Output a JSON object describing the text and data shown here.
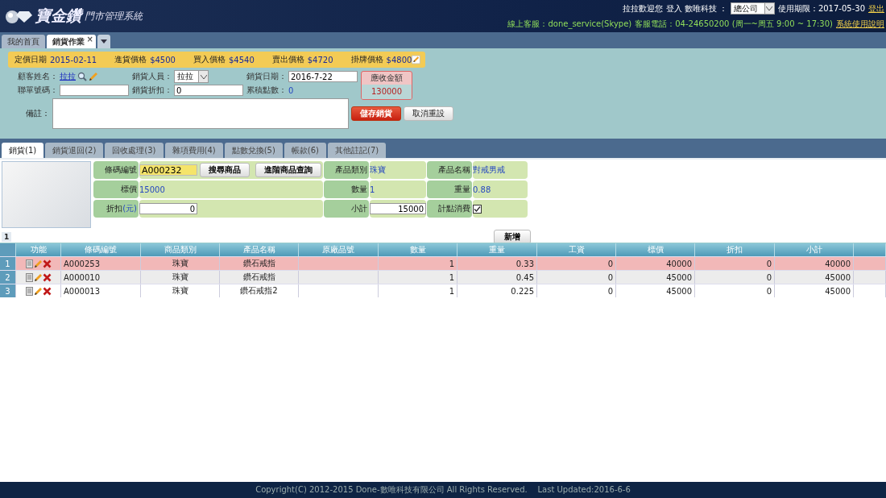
{
  "header": {
    "logo": "寶金鑽",
    "subtitle": "門市管理系統",
    "welcome": "拉拉歡迎您",
    "login_label": "登入 數唯科技 ：",
    "branch": "總公司",
    "expiry": "使用期限：2017-05-30",
    "logout": "登出",
    "support": "線上客服：done_service(Skype)",
    "phone": "客服電話：04-24650200 (周一~周五 9:00 ~ 17:30)",
    "manual": "系統使用說明"
  },
  "page_tabs": [
    {
      "label": "我的首頁",
      "selected": false
    },
    {
      "label": "銷貨作業",
      "selected": true,
      "close": "×"
    }
  ],
  "price_bar": {
    "date_label": "定價日期",
    "date": "2015-02-11",
    "prices": [
      {
        "label": "進貨價格",
        "value": "$4500"
      },
      {
        "label": "買入價格",
        "value": "$4540"
      },
      {
        "label": "賣出價格",
        "value": "$4720"
      },
      {
        "label": "掛牌價格",
        "value": "$4800"
      }
    ]
  },
  "form": {
    "customer_label": "顧客姓名：",
    "customer": "拉拉",
    "seller_label": "銷貨人員：",
    "seller": "拉拉",
    "date_label": "銷貨日期：",
    "date": "2016-7-22",
    "receivable_label": "應收金額",
    "receivable": "130000",
    "slip_label": "聯單號碼：",
    "discount_label": "銷貨折扣：",
    "discount": "0",
    "points_label": "累積點數：",
    "points": "0",
    "note_label": "備註：",
    "save": "儲存銷貨",
    "cancel": "取消重設"
  },
  "detail_tabs": [
    {
      "label": "銷貨(1)",
      "selected": true
    },
    {
      "label": "銷貨退回(2)",
      "selected": false
    },
    {
      "label": "回收處理(3)",
      "selected": false
    },
    {
      "label": "雜項費用(4)",
      "selected": false
    },
    {
      "label": "點數兌換(5)",
      "selected": false
    },
    {
      "label": "帳款(6)",
      "selected": false
    },
    {
      "label": "其他註記(7)",
      "selected": false
    }
  ],
  "product": {
    "barcode_label": "條碼編號",
    "barcode": "A000232",
    "search": "搜尋商品",
    "advanced": "進階商品查詢",
    "category_label": "產品類別",
    "category": "珠寶",
    "name_label": "產品名稱",
    "name": "對戒男戒",
    "price_label": "標價",
    "price": "15000",
    "qty_label": "數量",
    "qty": "1",
    "weight_label": "重量",
    "weight": "0.88",
    "discount_label": "折扣",
    "discount_unit": "(元)",
    "discount": "0",
    "subtotal_label": "小計",
    "subtotal": "15000",
    "points_label": "計點消費",
    "points_checked": true,
    "add": "新增"
  },
  "pager": {
    "page": "1"
  },
  "table": {
    "columns": [
      "功能",
      "條碼編號",
      "商品類別",
      "產品名稱",
      "原廠品號",
      "數量",
      "重量",
      "工資",
      "標價",
      "折扣",
      "小計"
    ],
    "rows": [
      {
        "index": "1",
        "selected": true,
        "barcode": "A000253",
        "category": "珠寶",
        "product": "鑽石戒指",
        "qty": "1",
        "weight": "0.33",
        "labor": "0",
        "price": "40000",
        "discount": "0",
        "subtotal": "40000"
      },
      {
        "index": "2",
        "selected": false,
        "barcode": "A000010",
        "category": "珠寶",
        "product": "鑽石戒指",
        "qty": "1",
        "weight": "0.45",
        "labor": "0",
        "price": "45000",
        "discount": "0",
        "subtotal": "45000"
      },
      {
        "index": "3",
        "selected": false,
        "barcode": "A000013",
        "category": "珠寶",
        "product": "鑽石戒指2",
        "qty": "1",
        "weight": "0.225",
        "labor": "0",
        "price": "45000",
        "discount": "0",
        "subtotal": "45000"
      }
    ]
  },
  "footer": "Copyright(C) 2012-2015 Done-數唯科技有限公司 All Rights Reserved.    Last Updated:2016-6-6"
}
